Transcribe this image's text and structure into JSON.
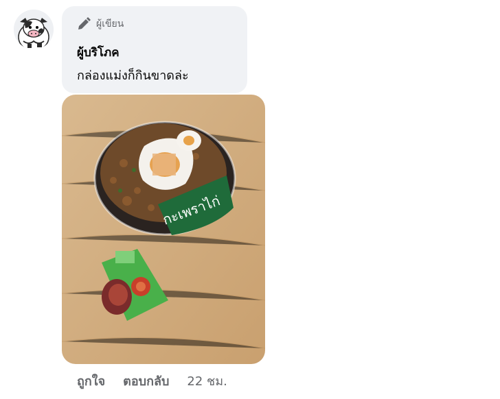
{
  "comment": {
    "badge_label": "ผู้เขียน",
    "author": "ผู้บริโภค",
    "text": "กล่องแม่งก็กินขาดล่ะ"
  },
  "photo": {
    "product_label": "กะเพราไก่"
  },
  "actions": {
    "like": "ถูกใจ",
    "reply": "ตอบกลับ",
    "time": "22 ชม."
  }
}
